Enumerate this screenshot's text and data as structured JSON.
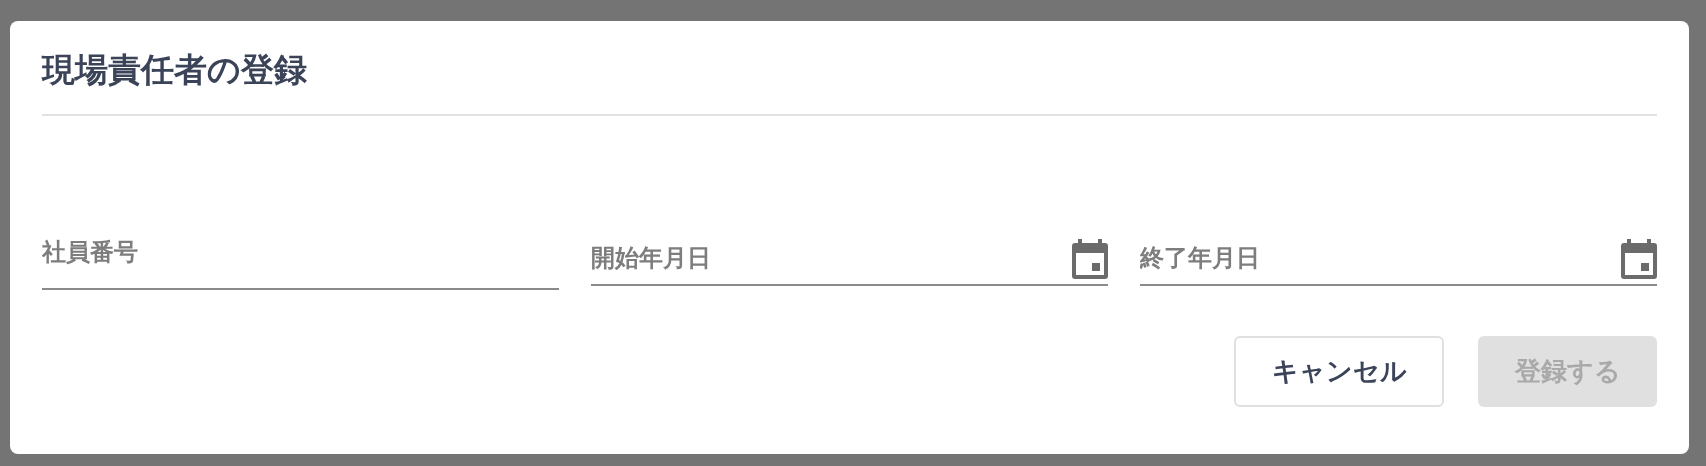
{
  "dialog": {
    "title": "現場責任者の登録",
    "fields": [
      {
        "placeholder": "社員番号",
        "kind": "text"
      },
      {
        "placeholder": "開始年月日",
        "kind": "date"
      },
      {
        "placeholder": "終了年月日",
        "kind": "date"
      }
    ],
    "buttons": [
      {
        "label": "キャンセル",
        "disabled": false
      },
      {
        "label": "登録する",
        "disabled": true
      }
    ]
  }
}
